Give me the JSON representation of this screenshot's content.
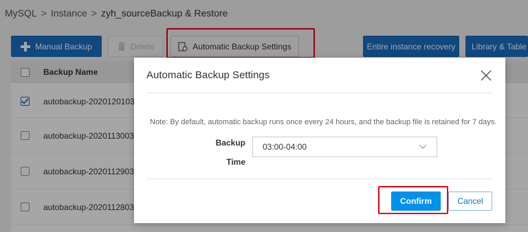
{
  "breadcrumb": {
    "items": [
      "MySQL",
      "Instance",
      "zyh_sourceBackup & Restore"
    ],
    "separator": ">"
  },
  "toolbar": {
    "manual_backup": "Manual Backup",
    "delete": "Delete",
    "auto_settings": "Automatic Backup Settings",
    "instance_recovery": "Entire instance recovery",
    "library_table": "Library & Table"
  },
  "table": {
    "header_backup_name": "Backup Name",
    "rows": [
      {
        "name": "autobackup-2020120103...",
        "checked": true
      },
      {
        "name": "autobackup-2020113003...",
        "checked": false
      },
      {
        "name": "autobackup-2020112903...",
        "checked": false
      },
      {
        "name": "autobackup-2020112803...",
        "checked": false
      }
    ]
  },
  "modal": {
    "title": "Automatic Backup Settings",
    "note": "Note: By default, automatic backup runs once every 24 hours, and the backup file is retained for 7 days.",
    "backup_label_line1": "Backup",
    "backup_label_line2": "Time",
    "backup_time_value": "03:00-04:00",
    "confirm": "Confirm",
    "cancel": "Cancel"
  },
  "colors": {
    "primary": "#1a6fc4",
    "confirm": "#0091ea",
    "highlight": "#e60012"
  }
}
